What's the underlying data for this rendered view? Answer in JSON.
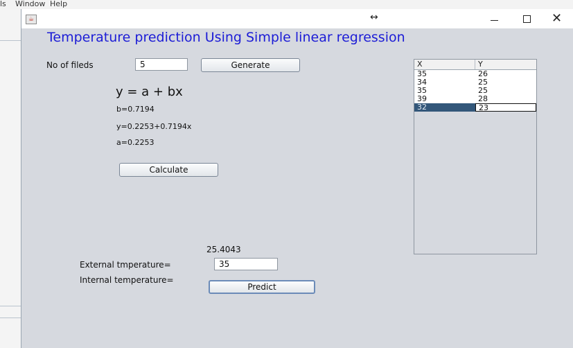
{
  "background_menu": {
    "items": [
      "ls",
      "Window",
      "Help"
    ]
  },
  "window": {
    "resize_glyph": "↔",
    "close_glyph": "✕"
  },
  "heading": "Temperature prediction Using Simple linear regression",
  "fields_row": {
    "label": "No of fileds",
    "value": "5",
    "generate_label": "Generate"
  },
  "formula": {
    "general": "y = a + bx",
    "b_text": "b=0.7194",
    "equation_text": "y=0.2253+0.7194x",
    "a_text": "a=0.2253",
    "calculate_label": "Calculate"
  },
  "table": {
    "columns": [
      "X",
      "Y"
    ],
    "rows": [
      {
        "x": "35",
        "y": "26"
      },
      {
        "x": "34",
        "y": "25"
      },
      {
        "x": "35",
        "y": "25"
      },
      {
        "x": "39",
        "y": "28"
      },
      {
        "x": "32",
        "y": "23"
      }
    ],
    "selected_row_index": 4
  },
  "prediction": {
    "result": "25.4043",
    "external_label": "External tmperature=",
    "external_value": "35",
    "internal_label": "Internal temperature=",
    "predict_label": "Predict"
  },
  "colors": {
    "heading": "#1c1cd6",
    "window_bg": "#d6d9df",
    "selected_row": "#33577a"
  }
}
